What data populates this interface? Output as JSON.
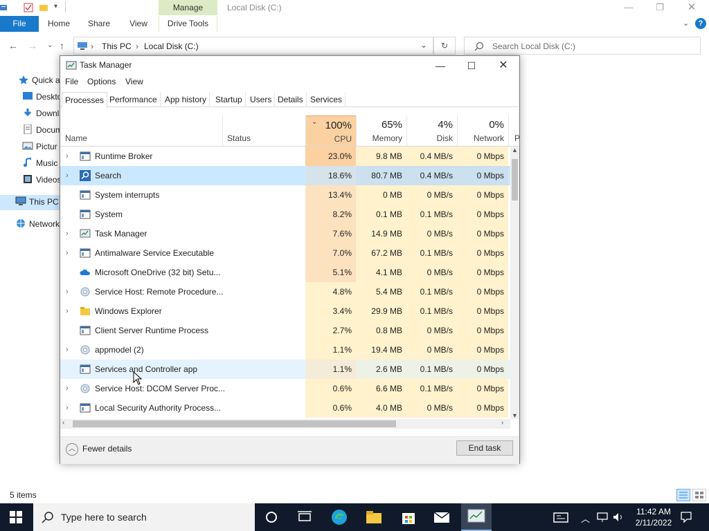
{
  "explorer": {
    "context_tab": "Manage",
    "window_title": "Local Disk (C:)",
    "ribbon_tabs": [
      "File",
      "Home",
      "Share",
      "View",
      "Drive Tools"
    ],
    "address": {
      "seg1": "This PC",
      "seg2": "Local Disk (C:)"
    },
    "search_placeholder": "Search Local Disk (C:)",
    "nav": [
      {
        "label": "Quick a",
        "icon": "star-icon"
      },
      {
        "label": "Deskto",
        "icon": "desktop-icon"
      },
      {
        "label": "Downl",
        "icon": "download-icon"
      },
      {
        "label": "Docum",
        "icon": "document-icon"
      },
      {
        "label": "Pictur",
        "icon": "pictures-icon"
      },
      {
        "label": "Music",
        "icon": "music-icon"
      },
      {
        "label": "Videos",
        "icon": "video-icon"
      },
      {
        "label": "This PC",
        "icon": "pc-icon"
      },
      {
        "label": "Network",
        "icon": "network-icon"
      }
    ],
    "status": "5 items"
  },
  "task_manager": {
    "title": "Task Manager",
    "menu": [
      "File",
      "Options",
      "View"
    ],
    "tabs": [
      "Processes",
      "Performance",
      "App history",
      "Startup",
      "Users",
      "Details",
      "Services"
    ],
    "active_tab": "Processes",
    "columns": {
      "name": "Name",
      "status": "Status",
      "cpu": {
        "pct": "100%",
        "label": "CPU"
      },
      "memory": {
        "pct": "65%",
        "label": "Memory"
      },
      "disk": {
        "pct": "4%",
        "label": "Disk"
      },
      "network": {
        "pct": "0%",
        "label": "Network"
      },
      "power_trunc": "P"
    },
    "processes": [
      {
        "name": "Runtime Broker",
        "cpu": "23.0%",
        "mem": "9.8 MB",
        "disk": "0.4 MB/s",
        "net": "0 Mbps",
        "expand": true,
        "icon": "window-icon"
      },
      {
        "name": "Search",
        "cpu": "18.6%",
        "mem": "80.7 MB",
        "disk": "0.4 MB/s",
        "net": "0 Mbps",
        "expand": true,
        "icon": "search-app-icon"
      },
      {
        "name": "System interrupts",
        "cpu": "13.4%",
        "mem": "0 MB",
        "disk": "0 MB/s",
        "net": "0 Mbps",
        "expand": false,
        "icon": "window-icon"
      },
      {
        "name": "System",
        "cpu": "8.2%",
        "mem": "0.1 MB",
        "disk": "0.1 MB/s",
        "net": "0 Mbps",
        "expand": false,
        "icon": "window-icon"
      },
      {
        "name": "Task Manager",
        "cpu": "7.6%",
        "mem": "14.9 MB",
        "disk": "0 MB/s",
        "net": "0 Mbps",
        "expand": true,
        "icon": "task-manager-icon"
      },
      {
        "name": "Antimalware Service Executable",
        "cpu": "7.0%",
        "mem": "67.2 MB",
        "disk": "0.1 MB/s",
        "net": "0 Mbps",
        "expand": true,
        "icon": "window-icon"
      },
      {
        "name": "Microsoft OneDrive (32 bit) Setu...",
        "cpu": "5.1%",
        "mem": "4.1 MB",
        "disk": "0 MB/s",
        "net": "0 Mbps",
        "expand": false,
        "icon": "cloud-icon"
      },
      {
        "name": "Service Host: Remote Procedure...",
        "cpu": "4.8%",
        "mem": "5.4 MB",
        "disk": "0.1 MB/s",
        "net": "0 Mbps",
        "expand": true,
        "icon": "gear-icon"
      },
      {
        "name": "Windows Explorer",
        "cpu": "3.4%",
        "mem": "29.9 MB",
        "disk": "0.1 MB/s",
        "net": "0 Mbps",
        "expand": true,
        "icon": "folder-icon"
      },
      {
        "name": "Client Server Runtime Process",
        "cpu": "2.7%",
        "mem": "0.8 MB",
        "disk": "0 MB/s",
        "net": "0 Mbps",
        "expand": false,
        "icon": "window-icon"
      },
      {
        "name": "appmodel (2)",
        "cpu": "1.1%",
        "mem": "19.4 MB",
        "disk": "0 MB/s",
        "net": "0 Mbps",
        "expand": true,
        "icon": "gear-icon"
      },
      {
        "name": "Services and Controller app",
        "cpu": "1.1%",
        "mem": "2.6 MB",
        "disk": "0.1 MB/s",
        "net": "0 Mbps",
        "expand": false,
        "icon": "window-icon"
      },
      {
        "name": "Service Host: DCOM Server Proc...",
        "cpu": "0.6%",
        "mem": "6.6 MB",
        "disk": "0.1 MB/s",
        "net": "0 Mbps",
        "expand": true,
        "icon": "gear-icon"
      },
      {
        "name": "Local Security Authority Process...",
        "cpu": "0.6%",
        "mem": "4.0 MB",
        "disk": "0 MB/s",
        "net": "0 Mbps",
        "expand": true,
        "icon": "window-icon"
      }
    ],
    "selected_row": 1,
    "hover_row": 11,
    "fewer_details": "Fewer details",
    "end_task": "End task"
  },
  "taskbar": {
    "search_placeholder": "Type here to search",
    "time": "11:42 AM",
    "date": "2/11/2022"
  },
  "colors": {
    "accent": "#1979ca",
    "selected": "#cce8ff",
    "cpu_header": "#fbd1a2",
    "taskbar": "#101a2a"
  }
}
